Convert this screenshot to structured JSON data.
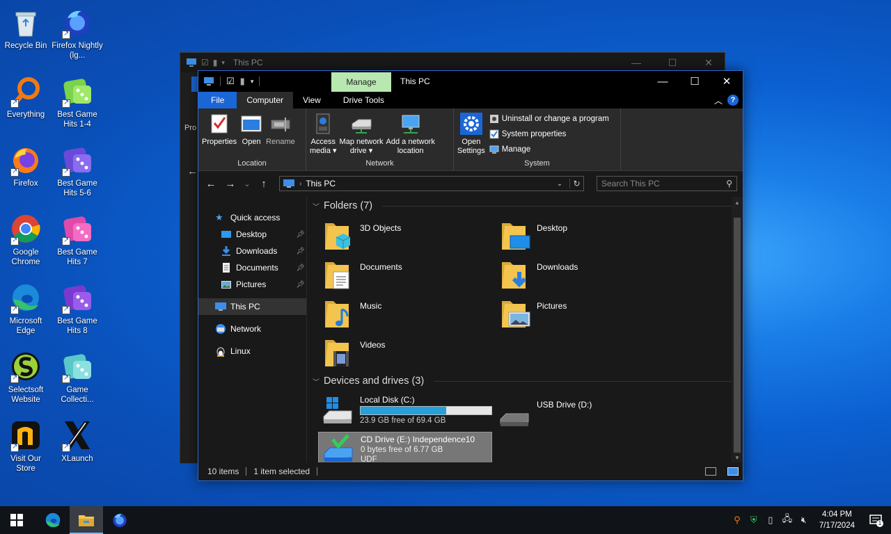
{
  "desktop": {
    "icons": [
      {
        "label": "Recycle Bin"
      },
      {
        "label": "Firefox Nightly (lg..."
      },
      {
        "label": "Everything"
      },
      {
        "label": "Best Game Hits 1-4"
      },
      {
        "label": "Firefox"
      },
      {
        "label": "Best Game Hits 5-6"
      },
      {
        "label": "Google Chrome"
      },
      {
        "label": "Best Game Hits 7"
      },
      {
        "label": "Microsoft Edge"
      },
      {
        "label": "Best Game Hits 8"
      },
      {
        "label": "Selectsoft Website"
      },
      {
        "label": "Game Collecti..."
      },
      {
        "label": "Visit Our Store"
      },
      {
        "label": "XLaunch"
      }
    ]
  },
  "back_window": {
    "title": "This PC",
    "min": "—",
    "max": "☐",
    "close": "✕",
    "partial_label": "Pro"
  },
  "window": {
    "title": "This PC",
    "context_tab": "Manage",
    "controls": {
      "minimize": "—",
      "maximize": "☐",
      "close": "✕"
    },
    "tabs": {
      "file": "File",
      "computer": "Computer",
      "view": "View",
      "drive_tools": "Drive Tools"
    },
    "ribbon": {
      "location": {
        "name": "Location",
        "properties": "Properties",
        "open": "Open",
        "rename": "Rename"
      },
      "network": {
        "name": "Network",
        "access_media_1": "Access",
        "access_media_2": "media ▾",
        "map_drive_1": "Map network",
        "map_drive_2": "drive ▾",
        "add_location_1": "Add a network",
        "add_location_2": "location"
      },
      "system": {
        "name": "System",
        "open_settings_1": "Open",
        "open_settings_2": "Settings",
        "uninstall": "Uninstall or change a program",
        "system_properties": "System properties",
        "manage": "Manage"
      }
    },
    "navbar": {
      "back": "←",
      "forward": "→",
      "recent": "⌄",
      "up": "↑",
      "path": "This PC",
      "search_placeholder": "Search This PC"
    },
    "nav_pane": {
      "quick_access": "Quick access",
      "desktop": "Desktop",
      "downloads": "Downloads",
      "documents": "Documents",
      "pictures": "Pictures",
      "this_pc": "This PC",
      "network": "Network",
      "linux": "Linux"
    },
    "folders_header": "Folders (7)",
    "folders": [
      {
        "name": "3D Objects"
      },
      {
        "name": "Desktop"
      },
      {
        "name": "Documents"
      },
      {
        "name": "Downloads"
      },
      {
        "name": "Music"
      },
      {
        "name": "Pictures"
      },
      {
        "name": "Videos"
      }
    ],
    "devices_header": "Devices and drives (3)",
    "drives": {
      "c": {
        "name": "Local Disk (C:)",
        "free": "23.9 GB free of 69.4 GB",
        "used_fraction": 0.656
      },
      "d": {
        "name": "USB Drive (D:)"
      },
      "e": {
        "name": "CD Drive (E:) Independence10",
        "free": "0 bytes free of 6.77 GB",
        "fs": "UDF"
      }
    },
    "status": {
      "items": "10 items",
      "selected": "1 item selected"
    }
  },
  "taskbar": {
    "time": "4:04 PM",
    "date": "7/17/2024",
    "notifications": "1"
  },
  "colors": {
    "accent": "#1b66d6",
    "manage_tab": "#b8e8b0",
    "progress": "#26a0da",
    "folder": "#f3c44e"
  }
}
